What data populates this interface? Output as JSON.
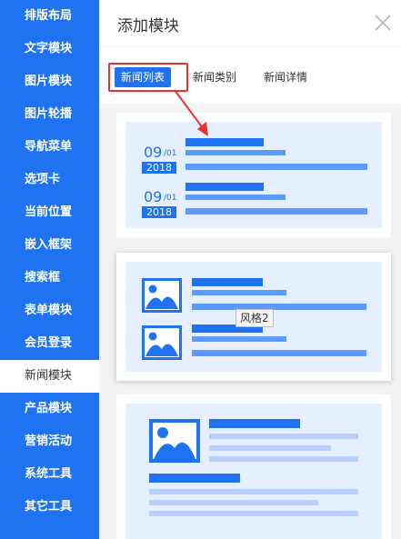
{
  "sidebar": {
    "items": [
      {
        "label": "排版布局"
      },
      {
        "label": "文字模块"
      },
      {
        "label": "图片模块"
      },
      {
        "label": "图片轮播"
      },
      {
        "label": "导航菜单"
      },
      {
        "label": "选项卡"
      },
      {
        "label": "当前位置"
      },
      {
        "label": "嵌入框架"
      },
      {
        "label": "搜索框"
      },
      {
        "label": "表单模块"
      },
      {
        "label": "会员登录"
      },
      {
        "label": "新闻模块"
      },
      {
        "label": "产品模块"
      },
      {
        "label": "营销活动"
      },
      {
        "label": "系统工具"
      },
      {
        "label": "其它工具"
      }
    ],
    "active_index": 11
  },
  "panel": {
    "title": "添加模块",
    "close_icon": "close-x-icon"
  },
  "tabs": [
    {
      "label": "新闻列表",
      "active": true
    },
    {
      "label": "新闻类别",
      "active": false
    },
    {
      "label": "新闻详情",
      "active": false
    }
  ],
  "styles": {
    "style1": {
      "dates": [
        {
          "day": "09",
          "month": "/01",
          "year": "2018"
        },
        {
          "day": "09",
          "month": "/01",
          "year": "2018"
        }
      ]
    },
    "style2": {
      "tooltip": "风格2",
      "image_icon": "image-placeholder-icon"
    },
    "style3": {
      "image_icon": "image-placeholder-icon"
    }
  },
  "colors": {
    "accent": "#1f73f1",
    "card_bg": "#e5efff",
    "bar_mid": "#5b9bff",
    "bar_light": "#b9d1fa",
    "highlight": "#e83232"
  }
}
